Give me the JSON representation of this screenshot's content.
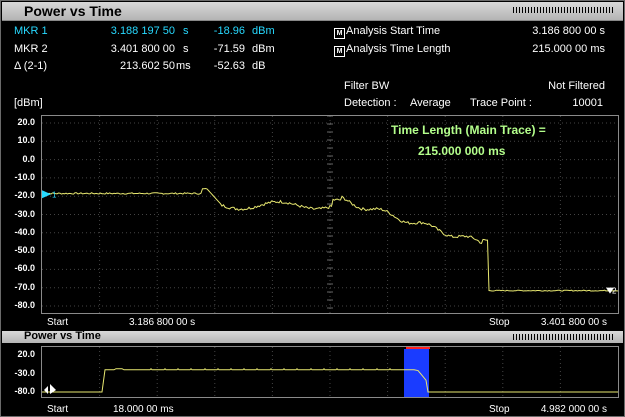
{
  "window": {
    "title": "Power vs Time"
  },
  "markers": [
    {
      "name": "MKR 1",
      "time": "3.188 197 50",
      "time_unit": "s",
      "level": "-18.96",
      "level_unit": "dBm",
      "active": true
    },
    {
      "name": "MKR 2",
      "time": "3.401 800 00",
      "time_unit": "s",
      "level": "-71.59",
      "level_unit": "dBm",
      "active": false
    },
    {
      "name": "Δ (2-1)",
      "time": "213.602 50",
      "time_unit": "ms",
      "level": "-52.63",
      "level_unit": "dB",
      "active": false
    }
  ],
  "analysis": {
    "m_glyph": "M",
    "start_time_label": "Analysis Start Time",
    "start_time_value": "3.186 800 00 s",
    "length_label": "Analysis Time Length",
    "length_value": "215.000 00 ms"
  },
  "settings": {
    "filter_bw_label": "Filter BW",
    "filter_bw_value": "Not Filtered",
    "detection_label": "Detection :",
    "detection_value": "Average",
    "trace_point_label": "Trace Point :",
    "trace_point_value": "10001"
  },
  "main_plot": {
    "unit_label": "[dBm]",
    "y_ticks": [
      "20.0",
      "10.0",
      "0.0",
      "-10.0",
      "-20.0",
      "-30.0",
      "-40.0",
      "-50.0",
      "-60.0",
      "-70.0",
      "-80.0"
    ],
    "annotation_line1": "Time Length (Main Trace) =",
    "annotation_line2": "215.000 000 ms",
    "start_label": "Start",
    "start_value": "3.186 800 00 s",
    "stop_label": "Stop",
    "stop_value": "3.401 800 00 s",
    "marker1_glyph": "1",
    "marker2_glyph": "2",
    "trace_color": "#e8e870",
    "marker_color": "#27d9ff"
  },
  "overview_plot": {
    "title": "Power vs Time",
    "y_ticks": [
      "20.0",
      "-30.0",
      "-80.0"
    ],
    "start_label": "Start",
    "start_value": "18.000 00 ms",
    "stop_label": "Stop",
    "stop_value": "4.982 000 00 s",
    "highlight_color": "#1a3cff",
    "range_bar_color": "#ff2020"
  }
}
